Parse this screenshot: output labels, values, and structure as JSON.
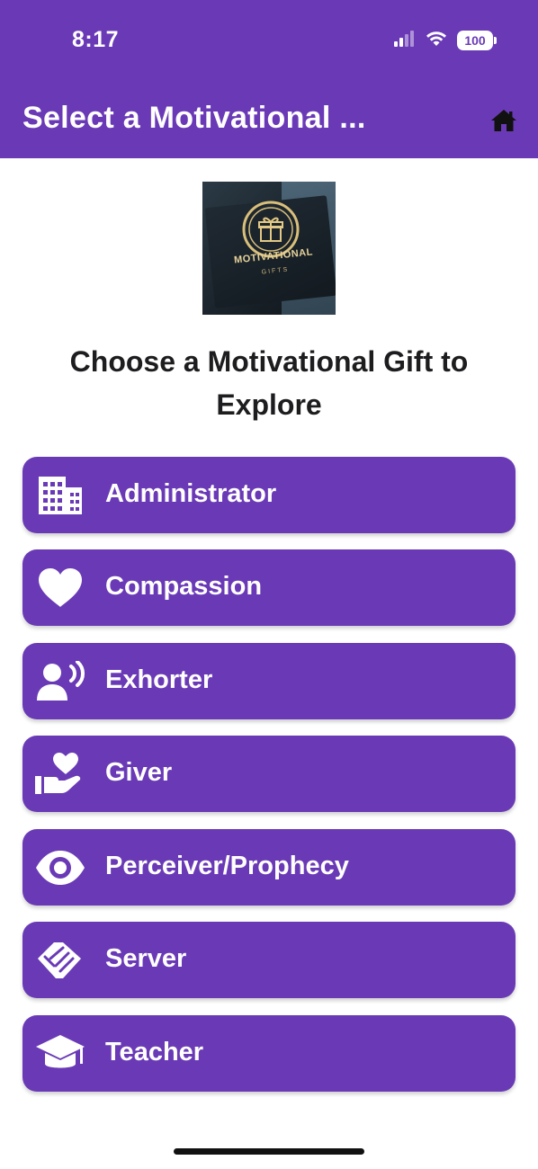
{
  "status_bar": {
    "time": "8:17",
    "battery": "100",
    "icons": [
      "signal-icon",
      "wifi-icon",
      "battery-icon"
    ]
  },
  "nav": {
    "title": "Select a Motivational ...",
    "home_icon": "home-icon"
  },
  "logo": {
    "text": "MOTIVATIONAL",
    "subtext": "GIFTS"
  },
  "heading": "Choose a Motivational Gift to Explore",
  "gifts": [
    {
      "label": "Administrator",
      "icon": "building-icon"
    },
    {
      "label": "Compassion",
      "icon": "heart-icon"
    },
    {
      "label": "Exhorter",
      "icon": "speaker-icon"
    },
    {
      "label": "Giver",
      "icon": "hand-heart-icon"
    },
    {
      "label": "Perceiver/Prophecy",
      "icon": "eye-icon"
    },
    {
      "label": "Server",
      "icon": "handshake-icon"
    },
    {
      "label": "Teacher",
      "icon": "graduation-cap-icon"
    }
  ],
  "colors": {
    "primary": "#6a3ab6",
    "text_dark": "#1d1d1f",
    "on_primary": "#ffffff"
  }
}
